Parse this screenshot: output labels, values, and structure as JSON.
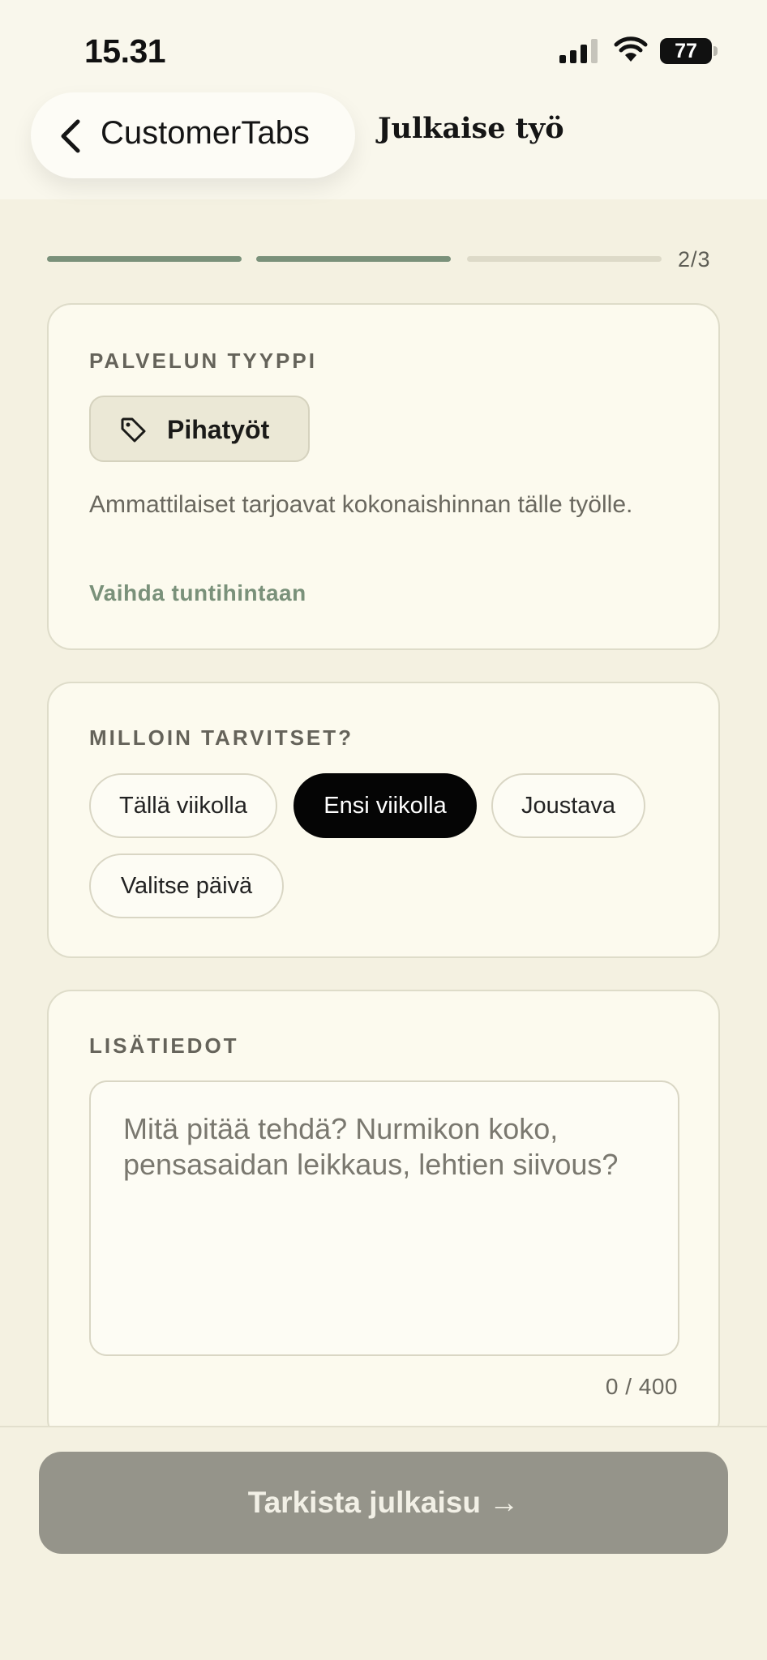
{
  "status_bar": {
    "time": "15.31",
    "battery_level": "77",
    "icons": [
      "cellular-signal-icon",
      "wifi-icon",
      "battery-icon"
    ]
  },
  "header": {
    "back_label": "CustomerTabs",
    "back_icon": "chevron-left-icon",
    "title": "Julkaise työ"
  },
  "progress": {
    "current_step": 2,
    "total_steps": 3,
    "label": "2/3",
    "colors": {
      "done": "#7a917a",
      "pending": "#dddac8"
    }
  },
  "service_type": {
    "section_label": "PALVELUN TYYPPI",
    "chip_icon": "tag-icon",
    "chip_label": "Pihatyöt",
    "description": "Ammattilaiset tarjoavat kokonaishinnan tälle työlle.",
    "link_label": "Vaihda tuntihintaan"
  },
  "timing": {
    "section_label": "MILLOIN TARVITSET?",
    "options": [
      "Tällä viikolla",
      "Ensi viikolla",
      "Joustava",
      "Valitse päivä"
    ],
    "selected": "Ensi viikolla"
  },
  "details": {
    "section_label": "LISÄTIEDOT",
    "value": "",
    "placeholder": "Mitä pitää tehdä? Nurmikon koko, pensasaidan leikkaus, lehtien siivous?",
    "counter": "0 / 400"
  },
  "footer": {
    "cta_label": "Tarkista julkaisu →"
  },
  "theme": {
    "background": "#f4f1e1",
    "card": "#fcfaee",
    "accent_green": "#7a917a",
    "selected_chip": "#050505",
    "cta_disabled": "#95948a"
  }
}
